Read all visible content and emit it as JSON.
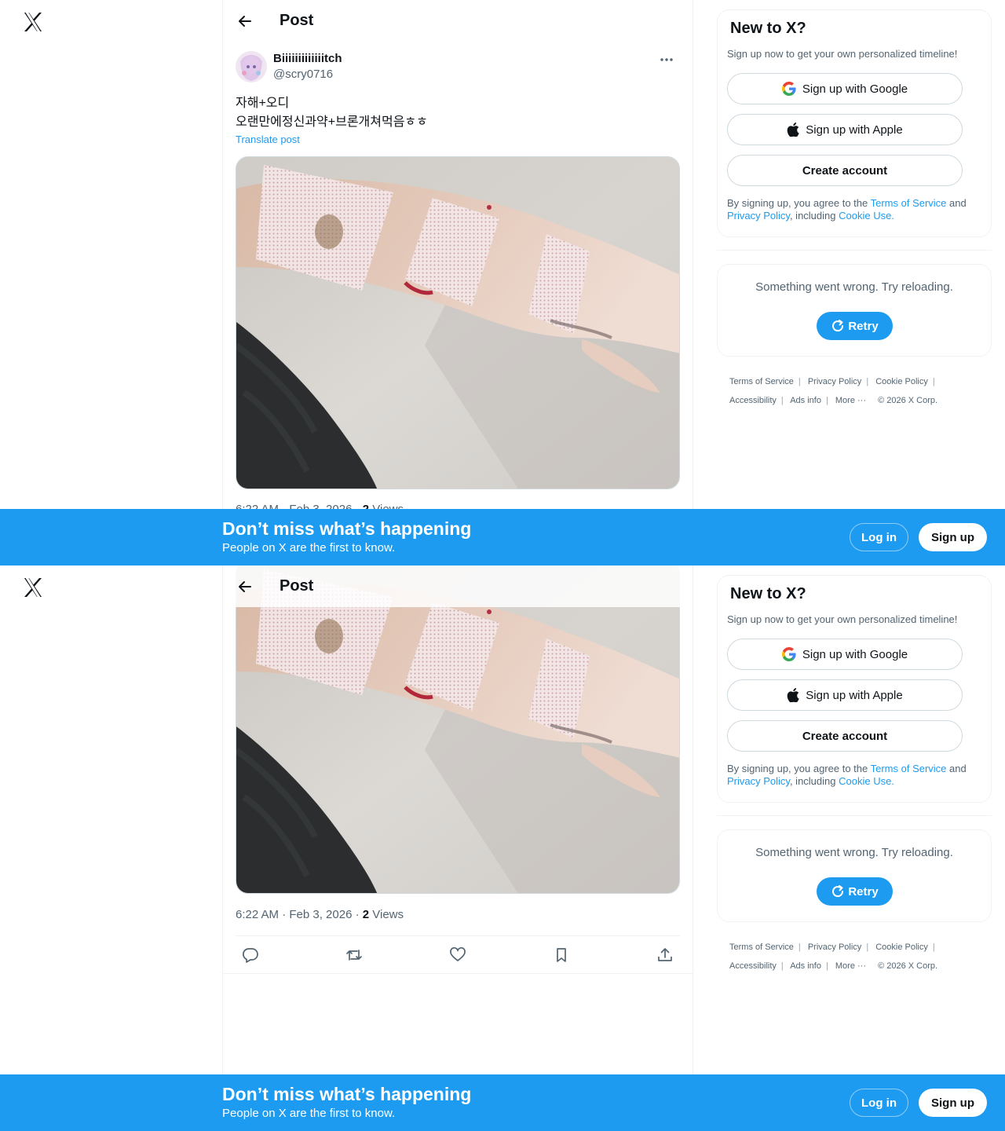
{
  "header": {
    "title": "Post"
  },
  "post": {
    "author_name": "Biiiiiiiiiiiiitch",
    "author_handle": "@scry0716",
    "text_line1": "자해+오디",
    "text_line2": "오랜만에정신과약+브론개쳐먹음ㅎㅎ",
    "translate_label": "Translate post",
    "time": "6:22 AM · Feb 3, 2026 · ",
    "views_count": "2",
    "views_label": " Views"
  },
  "sidebar": {
    "signup": {
      "title": "New to X?",
      "subtitle": "Sign up now to get your own personalized timeline!",
      "google_label": "Sign up with Google",
      "apple_label": "Sign up with Apple",
      "create_label": "Create account",
      "legal_prefix": "By signing up, you agree to the ",
      "terms_link": "Terms of Service",
      "legal_and": " and ",
      "privacy_link": "Privacy Policy",
      "legal_including": ", including ",
      "cookie_link": "Cookie Use."
    },
    "error": {
      "message": "Something went wrong. Try reloading.",
      "retry_label": "Retry"
    },
    "footer": {
      "terms": "Terms of Service",
      "privacy": "Privacy Policy",
      "cookie": "Cookie Policy",
      "accessibility": "Accessibility",
      "ads": "Ads info",
      "more": "More ···",
      "copyright": "© 2026 X Corp."
    }
  },
  "banner": {
    "title": "Don’t miss what’s happening",
    "subtitle": "People on X are the first to know.",
    "login_label": "Log in",
    "signup_label": "Sign up"
  },
  "icons": {
    "logo": "x-logo-icon",
    "back": "arrow-left-icon",
    "more": "more-horizontal-icon",
    "reply": "reply-icon",
    "repost": "repost-icon",
    "like": "heart-icon",
    "bookmark": "bookmark-icon",
    "share": "share-icon",
    "google": "google-icon",
    "apple": "apple-icon",
    "retry": "refresh-icon"
  },
  "colors": {
    "accent": "#1d9bf0",
    "text": "#0f1419",
    "muted": "#536471",
    "border": "#eff3f4"
  }
}
